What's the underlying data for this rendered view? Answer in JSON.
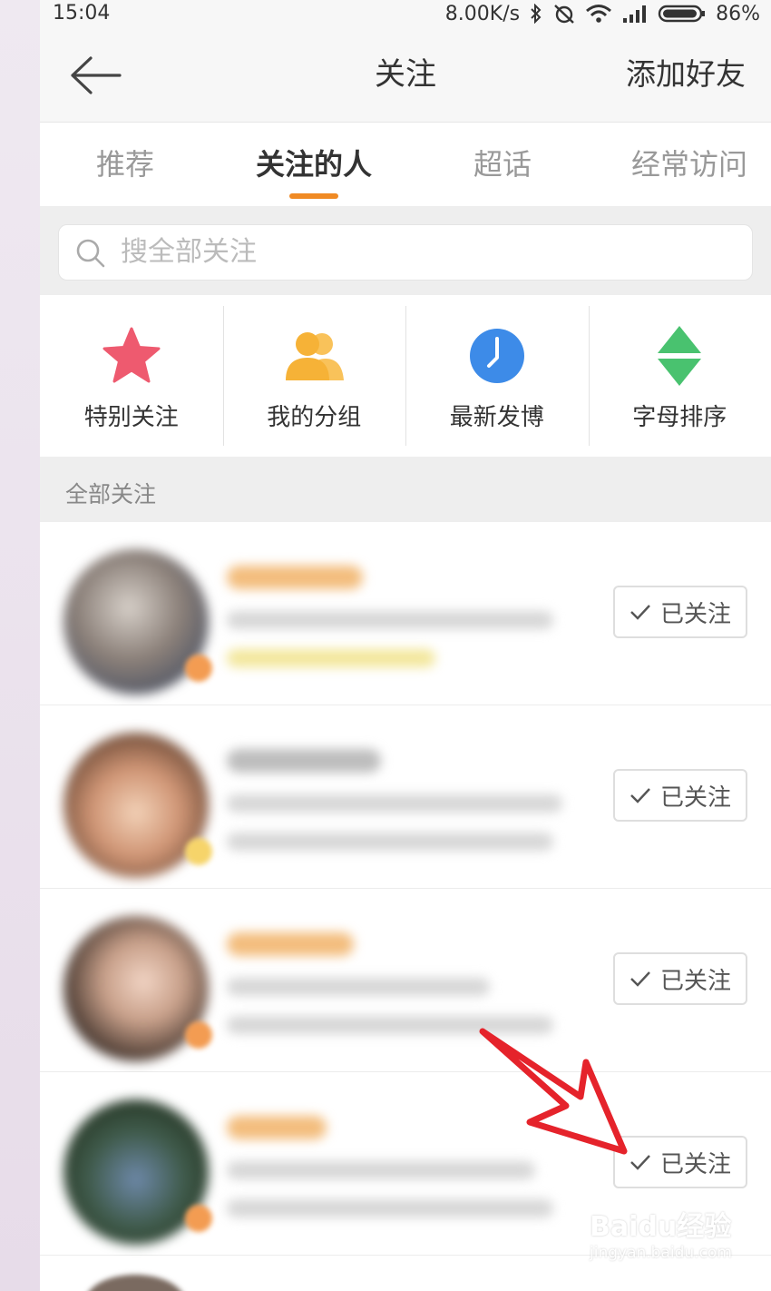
{
  "status_bar": {
    "time": "15:04",
    "speed": "8.00K/s",
    "battery": "86%"
  },
  "nav": {
    "title": "关注",
    "add_friend": "添加好友",
    "back_icon": "arrow-left-icon"
  },
  "tabs": [
    {
      "label": "推荐",
      "active": false
    },
    {
      "label": "关注的人",
      "active": true
    },
    {
      "label": "超话",
      "active": false
    },
    {
      "label": "经常访问",
      "active": false
    }
  ],
  "search": {
    "placeholder": "搜全部关注"
  },
  "quick_actions": [
    {
      "label": "特别关注",
      "icon": "star-icon"
    },
    {
      "label": "我的分组",
      "icon": "group-icon"
    },
    {
      "label": "最新发博",
      "icon": "clock-icon"
    },
    {
      "label": "字母排序",
      "icon": "sort-icon"
    }
  ],
  "section_header": "全部关注",
  "follow_rows": [
    {
      "button_label": "已关注"
    },
    {
      "button_label": "已关注"
    },
    {
      "button_label": "已关注"
    },
    {
      "button_label": "已关注"
    }
  ],
  "watermark": {
    "line1": "Baidu经验",
    "line2": "jingyan.baidu.com"
  },
  "colors": {
    "accent": "#f08a24",
    "star": "#ee5a6f",
    "group": "#f6b237",
    "clock": "#3d8be8",
    "sort": "#49c26f",
    "annotation_arrow": "#e5232b"
  }
}
